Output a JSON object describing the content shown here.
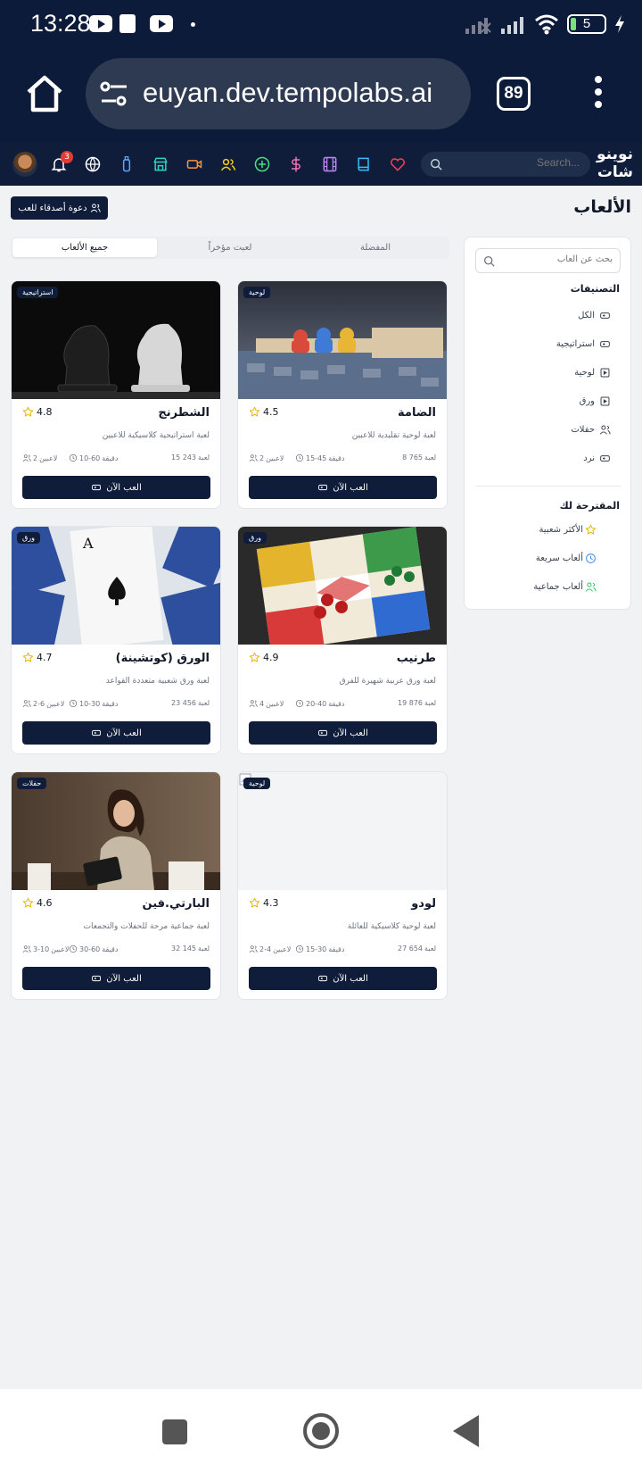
{
  "status_bar": {
    "time": "13:28",
    "battery": "5"
  },
  "browser": {
    "url": "euyan.dev.tempolabs.ai",
    "tab_count": "89"
  },
  "app_nav": {
    "brand_line1": "نوينو",
    "brand_line2": "شات",
    "search_placeholder": "Search...",
    "notification_count": "3"
  },
  "page": {
    "title": "الألعاب",
    "invite_label": "دعوة أصدقاء للعب"
  },
  "tabs": [
    {
      "label": "المفضلة"
    },
    {
      "label": "لعبت مؤخراً"
    },
    {
      "label": "جميع الألعاب",
      "active": true
    }
  ],
  "sidebar": {
    "search_placeholder": "بحث عن ألعاب",
    "categories_title": "التصنيفات",
    "categories": [
      {
        "label": "الكل",
        "icon": "gamepad-icon"
      },
      {
        "label": "استراتيجية",
        "icon": "gamepad-icon"
      },
      {
        "label": "لوحية",
        "icon": "board-icon"
      },
      {
        "label": "ورق",
        "icon": "board-icon"
      },
      {
        "label": "حفلات",
        "icon": "users-icon"
      },
      {
        "label": "نرد",
        "icon": "gamepad-icon"
      }
    ],
    "recommended_title": "المقترحة لك",
    "recommended": [
      {
        "label": "الأكثر شعبية",
        "icon": "star-icon",
        "color": "#eab308"
      },
      {
        "label": "ألعاب سريعة",
        "icon": "clock-icon",
        "color": "#3b82f6"
      },
      {
        "label": "ألعاب جماعية",
        "icon": "users-icon",
        "color": "#22c55e"
      }
    ]
  },
  "games": [
    {
      "name": "الضامة",
      "tag": "لوحية",
      "rating": "4.5",
      "description": "لعبة لوحية تقليدية للاعبين",
      "plays": "8 765",
      "plays_unit": "لعبة",
      "duration": "15-45",
      "duration_unit": "دقيقة",
      "players": "2",
      "players_unit": "لاعبين",
      "play_label": "العب الآن",
      "image": "board-game-pieces"
    },
    {
      "name": "الشطرنج",
      "tag": "استراتيجية",
      "rating": "4.8",
      "description": "لعبة استراتيجية كلاسيكية للاعبين",
      "plays": "15 243",
      "plays_unit": "لعبة",
      "duration": "10-60",
      "duration_unit": "دقيقة",
      "players": "2",
      "players_unit": "لاعبين",
      "play_label": "العب الآن",
      "image": "chess-knights"
    },
    {
      "name": "طرنيب",
      "tag": "ورق",
      "rating": "4.9",
      "description": "لعبة ورق عربية شهيرة للفرق",
      "plays": "19 876",
      "plays_unit": "لعبة",
      "duration": "20-40",
      "duration_unit": "دقيقة",
      "players": "4",
      "players_unit": "لاعبين",
      "play_label": "العب الآن",
      "image": "ludo-board"
    },
    {
      "name": "الورق (كوتشينة)",
      "tag": "ورق",
      "rating": "4.7",
      "description": "لعبة ورق شعبية متعددة القواعد",
      "plays": "23 456",
      "plays_unit": "لعبة",
      "duration": "10-30",
      "duration_unit": "دقيقة",
      "players": "2-6",
      "players_unit": "لاعبين",
      "play_label": "العب الآن",
      "image": "playing-cards"
    },
    {
      "name": "لودو",
      "tag": "لوحية",
      "rating": "4.3",
      "description": "لعبة لوحية كلاسيكية للعائلة",
      "plays": "27 654",
      "plays_unit": "لعبة",
      "duration": "15-30",
      "duration_unit": "دقيقة",
      "players": "2-4",
      "players_unit": "لاعبين",
      "play_label": "العب الآن",
      "image": "broken-image"
    },
    {
      "name": "البارتي.فين",
      "tag": "حفلات",
      "rating": "4.6",
      "description": "لعبة جماعية مرحة للحفلات والتجمعات",
      "plays": "32 145",
      "plays_unit": "لعبة",
      "duration": "30-60",
      "duration_unit": "دقيقة",
      "players": "3-10",
      "players_unit": "لاعبين",
      "play_label": "العب الآن",
      "image": "woman-with-tablet"
    }
  ],
  "colors": {
    "navy": "#0f1d3b",
    "star": "#eab308"
  }
}
